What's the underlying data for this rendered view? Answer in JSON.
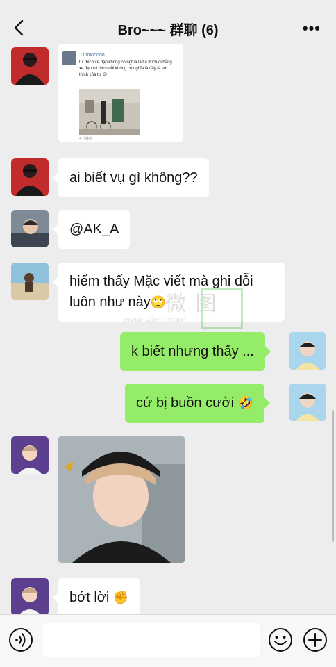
{
  "header": {
    "title": "Bro~~~ 群聊 (6)",
    "more_label": "•••"
  },
  "messages": {
    "card": {
      "username": "Linmooooo",
      "text": "tui thích xe đạp không có nghĩa là tui thích đi bằng xe đạp tui thích dỗi không có nghĩa là đấy là sở thích của tui 😉",
      "time": "4 分钟前"
    },
    "m1": "ai biết vụ gì không??",
    "m2": "@AK_A",
    "m3_text": "hiếm thấy Mặc viết mà ghi dỗi luôn như này",
    "m3_emoji": "🙄",
    "m4": "k biết nhưng thấy ...",
    "m5_text": "cứ bị buồn cười",
    "m5_emoji": "🤣",
    "m6_text": "bớt lời",
    "m6_emoji": "✊"
  },
  "watermark": {
    "cn": "微 图",
    "url": "www.vjietu.com"
  },
  "footer": {
    "input_value": "",
    "input_placeholder": ""
  },
  "icons": {
    "back": "chevron-left-icon",
    "voice": "voice-icon",
    "emoji": "smiley-icon",
    "plus": "plus-circle-icon"
  },
  "colors": {
    "background": "#ededed",
    "my_bubble": "#95ec69",
    "their_bubble": "#ffffff",
    "watermark_box": "#6fcf6f"
  }
}
